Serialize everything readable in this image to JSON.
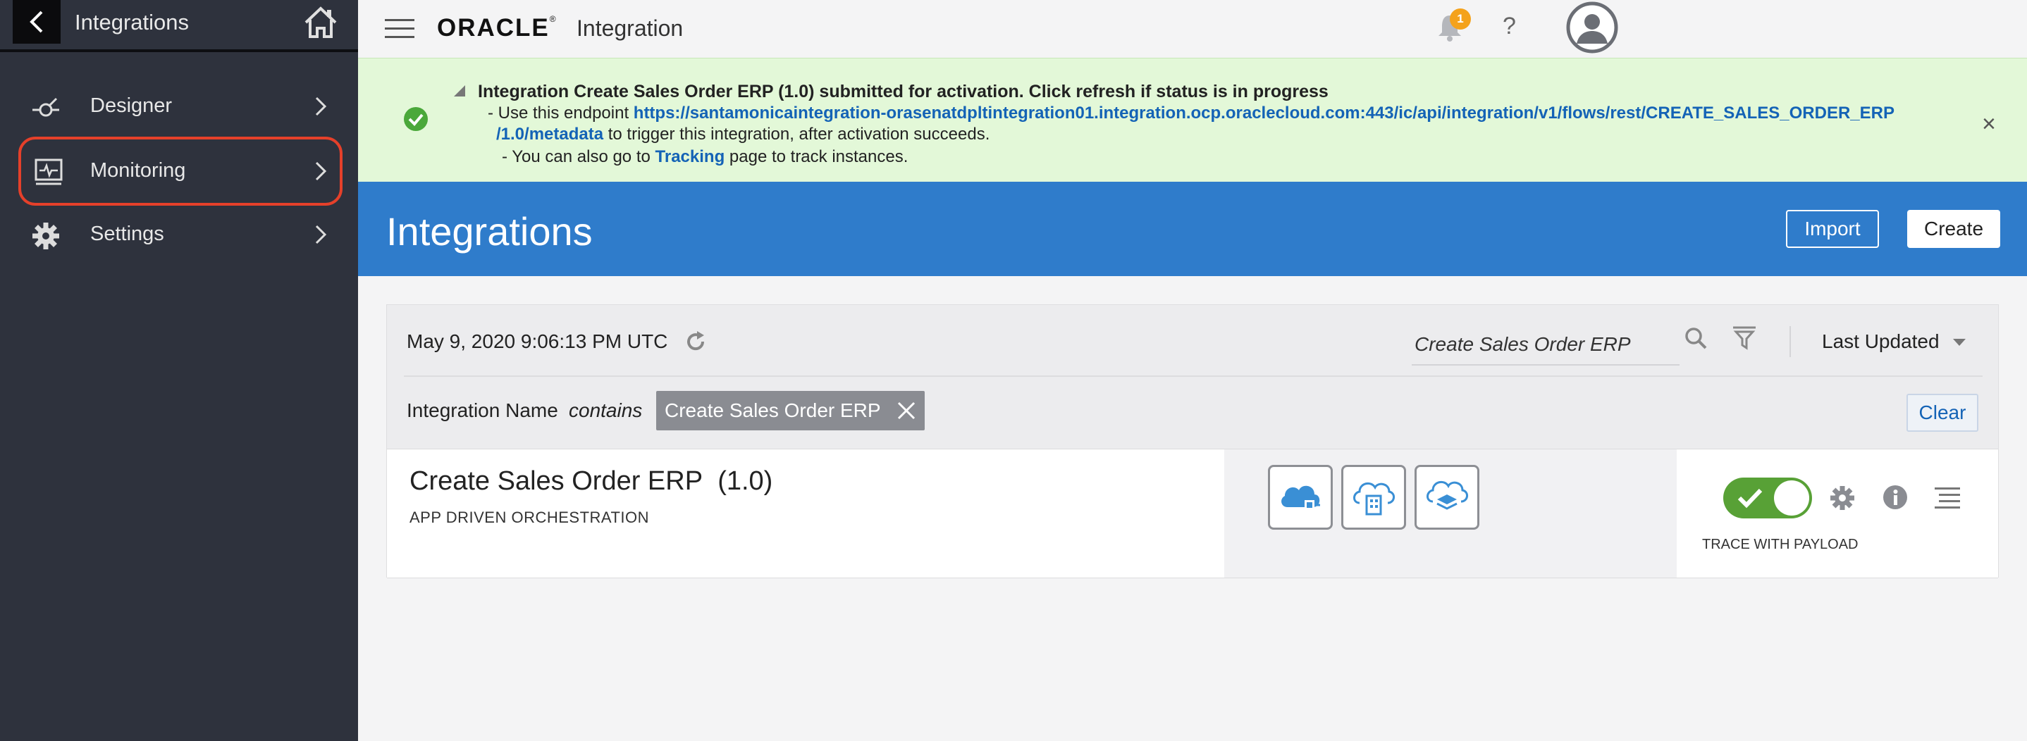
{
  "sidebar": {
    "title": "Integrations",
    "items": [
      {
        "label": "Designer",
        "icon": "designer-icon"
      },
      {
        "label": "Monitoring",
        "icon": "monitoring-icon"
      },
      {
        "label": "Settings",
        "icon": "gear-icon"
      }
    ]
  },
  "header": {
    "brand": "ORACLE",
    "product": "Integration",
    "notification_count": "1",
    "help": "?"
  },
  "banner": {
    "line1": "Integration Create Sales Order ERP (1.0) submitted for activation. Click refresh if status is in progress",
    "line2_prefix": "- Use this endpoint",
    "endpoint_part1": "https://santamonicaintegration-orasenatdpltintegration01.integration.ocp.oraclecloud.com:443/ic/api/integration/v1/flows/rest/CREATE_SALES_ORDER_ERP",
    "endpoint_part2": "/1.0/metadata",
    "line3_suffix": "to trigger this integration, after activation succeeds.",
    "line4_prefix": "- You can also go to",
    "tracking_link": "Tracking",
    "line4_suffix": "page to track instances.",
    "close": "×"
  },
  "hero": {
    "title": "Integrations",
    "import_label": "Import",
    "create_label": "Create"
  },
  "toolbar": {
    "timestamp": "May 9, 2020 9:06:13 PM UTC",
    "search_value": "Create Sales Order ERP",
    "sort_label": "Last Updated"
  },
  "filter": {
    "field": "Integration Name",
    "operator": "contains",
    "value": "Create Sales Order ERP",
    "clear_label": "Clear"
  },
  "integration": {
    "name": "Create Sales Order ERP",
    "version": "(1.0)",
    "pattern": "APP DRIVEN ORCHESTRATION",
    "trace": "TRACE WITH PAYLOAD",
    "active": true
  },
  "colors": {
    "sidebar_bg": "#2e323d",
    "hero_bg": "#2f7ccb",
    "banner_bg": "#e3f8d8",
    "toggle_on": "#58a136",
    "highlight": "#e5402a",
    "badge": "#f4a21b"
  }
}
